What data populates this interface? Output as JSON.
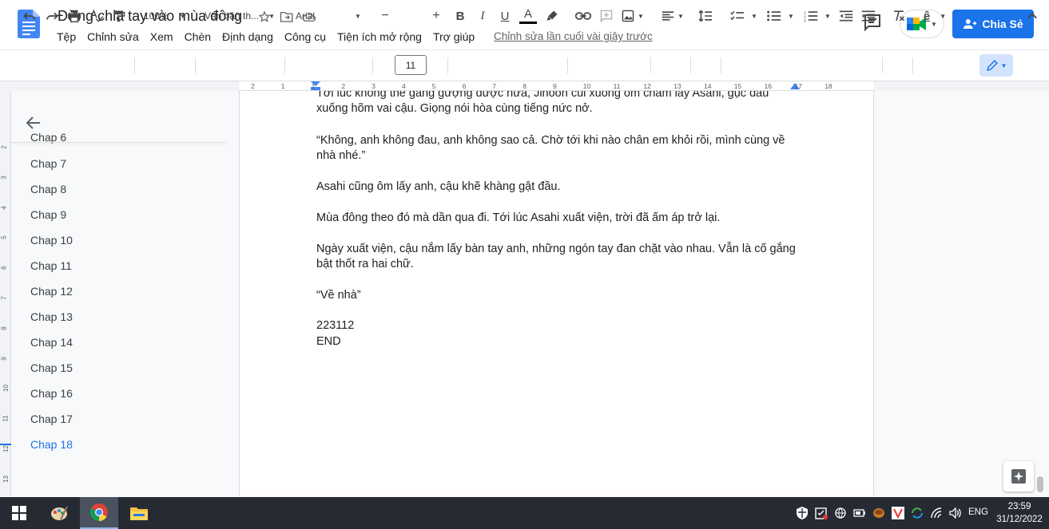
{
  "document": {
    "title": "Đừng chia tay vào mùa đông",
    "last_edit": "Chỉnh sửa lần cuối vài giây trước"
  },
  "menu": [
    "Tệp",
    "Chỉnh sửa",
    "Xem",
    "Chèn",
    "Định dạng",
    "Công cụ",
    "Tiện ích mở rộng",
    "Trợ giúp"
  ],
  "share": {
    "label": "Chia Sẻ"
  },
  "toolbar": {
    "zoom": "100%",
    "style": "Văn bản th...",
    "font": "Arial",
    "font_size": "11"
  },
  "ruler": [
    "2",
    "1",
    "1",
    "2",
    "3",
    "4",
    "5",
    "6",
    "7",
    "8",
    "9",
    "10",
    "11",
    "12",
    "13",
    "14",
    "15",
    "16",
    "17",
    "18"
  ],
  "vruler": [
    "2",
    "3",
    "4",
    "5",
    "6",
    "7",
    "8",
    "9",
    "10",
    "11",
    "12",
    "13",
    "14"
  ],
  "outline": {
    "items": [
      "Chap 6",
      "Chap 7",
      "Chap 8",
      "Chap 9",
      "Chap 10",
      "Chap 11",
      "Chap 12",
      "Chap 13",
      "Chap 14",
      "Chap 15",
      "Chap 16",
      "Chap 17",
      "Chap 18"
    ],
    "active": "Chap 18"
  },
  "content": {
    "p1": "Tới lúc không thể gắng gượng được nữa, Jihoon cúi xuống ôm chầm lấy Asahi, gục đầu xuống hõm vai cậu. Giọng nói hòa cùng tiếng nức nở.",
    "p2": "“Không, anh không đau, anh không sao cả. Chờ tới khi nào chân em khỏi rồi, mình cùng về nhà nhé.”",
    "p3": "Asahi cũng ôm lấy anh, cậu khẽ khàng gật đầu.",
    "p4": "Mùa đông theo đó mà dần qua đi. Tới lúc Asahi xuất viện, trời đã ấm áp trở lại.",
    "p5": "Ngày xuất viện, cậu nắm lấy bàn tay anh, những ngón tay đan chặt vào nhau. Vẫn là cố gắng bật thốt ra hai chữ.",
    "p6": "“Về nhà”",
    "p7": "223112",
    "p8": "END"
  },
  "taskbar": {
    "lang": "ENG",
    "time": "23:59",
    "date": "31/12/2022"
  },
  "colors": {
    "accent": "#1a73e8",
    "taskbar": "#262b33"
  }
}
